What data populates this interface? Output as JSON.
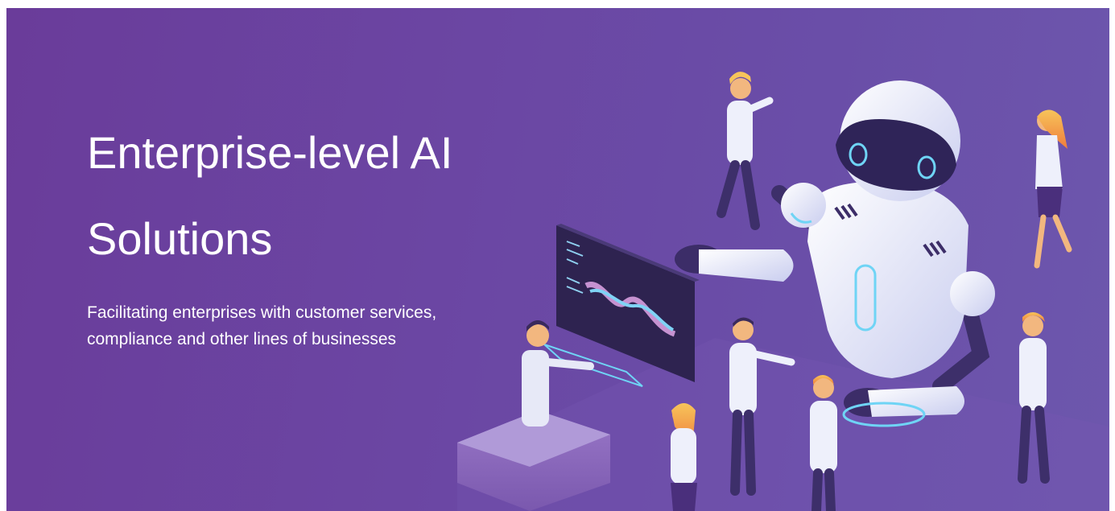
{
  "hero": {
    "title_line1": "Enterprise-level AI",
    "title_line2": "Solutions",
    "subtitle_line1": "Facilitating enterprises with customer services,",
    "subtitle_line2": "compliance and other lines of businesses"
  },
  "illustration": {
    "subject": "isometric AI robot with office workers"
  },
  "colors": {
    "background": "#6b46a3",
    "text": "#ffffff",
    "accent_cyan": "#5ad8f0",
    "robot_white": "#eef0fb",
    "skin_orange": "#f4a34a"
  }
}
